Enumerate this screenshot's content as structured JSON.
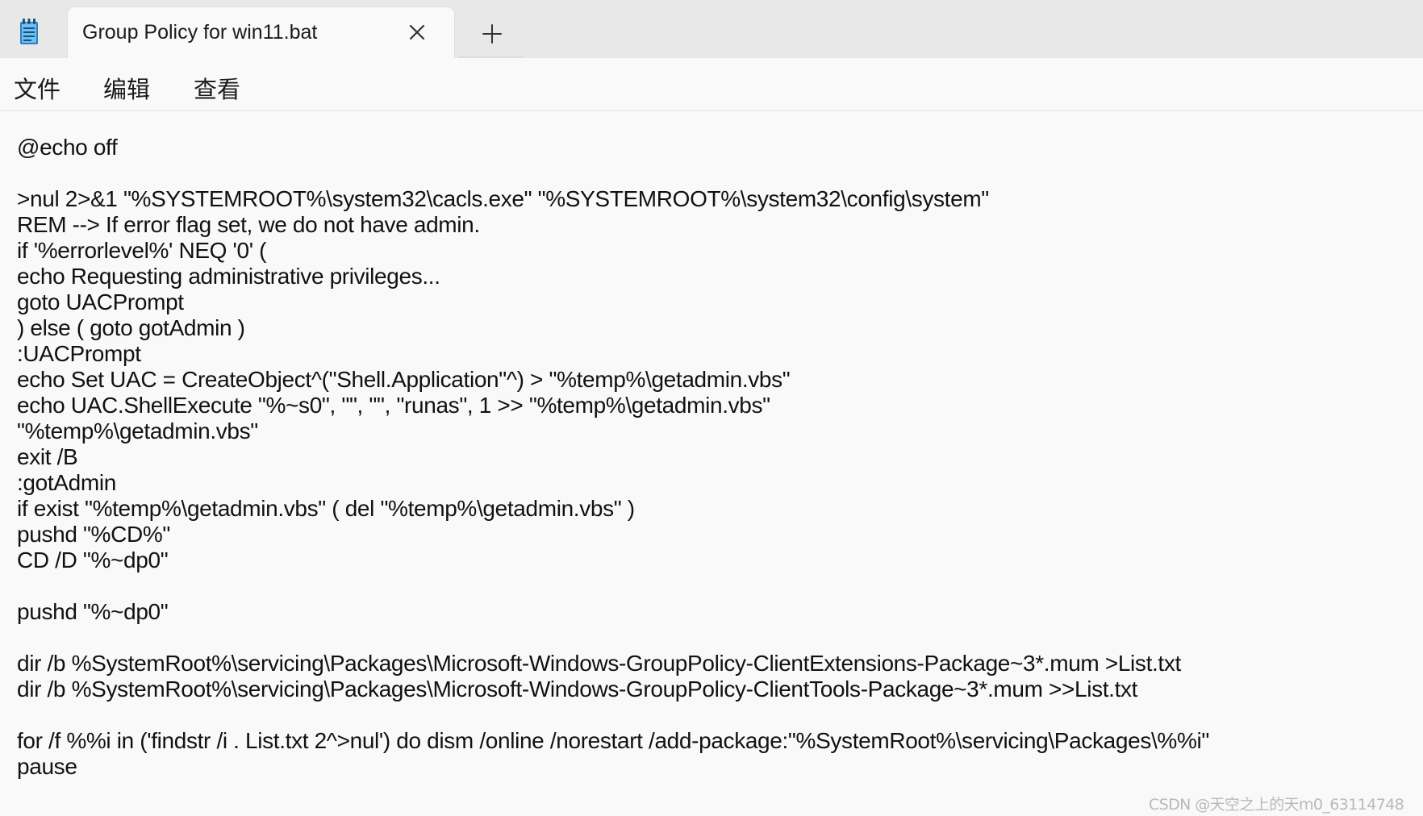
{
  "tab": {
    "title": "Group Policy for win11.bat",
    "icon": "notepad-icon",
    "close_icon": "close-icon",
    "new_tab_icon": "plus-icon"
  },
  "menu": {
    "items": [
      "文件",
      "编辑",
      "查看"
    ]
  },
  "editor": {
    "lines": [
      "@echo off",
      "",
      ">nul 2>&1 \"%SYSTEMROOT%\\system32\\cacls.exe\" \"%SYSTEMROOT%\\system32\\config\\system\"",
      "REM --> If error flag set, we do not have admin.",
      "if '%errorlevel%' NEQ '0' (",
      "echo Requesting administrative privileges...",
      "goto UACPrompt",
      ") else ( goto gotAdmin )",
      ":UACPrompt",
      "echo Set UAC = CreateObject^(\"Shell.Application\"^) > \"%temp%\\getadmin.vbs\"",
      "echo UAC.ShellExecute \"%~s0\", \"\", \"\", \"runas\", 1 >> \"%temp%\\getadmin.vbs\"",
      "\"%temp%\\getadmin.vbs\"",
      "exit /B",
      ":gotAdmin",
      "if exist \"%temp%\\getadmin.vbs\" ( del \"%temp%\\getadmin.vbs\" )",
      "pushd \"%CD%\"",
      "CD /D \"%~dp0\"",
      "",
      "pushd \"%~dp0\"",
      "",
      "dir /b %SystemRoot%\\servicing\\Packages\\Microsoft-Windows-GroupPolicy-ClientExtensions-Package~3*.mum >List.txt",
      "dir /b %SystemRoot%\\servicing\\Packages\\Microsoft-Windows-GroupPolicy-ClientTools-Package~3*.mum >>List.txt",
      "",
      "for /f %%i in ('findstr /i . List.txt 2^>nul') do dism /online /norestart /add-package:\"%SystemRoot%\\servicing\\Packages\\%%i\"",
      "pause"
    ]
  },
  "watermark": "CSDN @天空之上的天m0_63114748"
}
